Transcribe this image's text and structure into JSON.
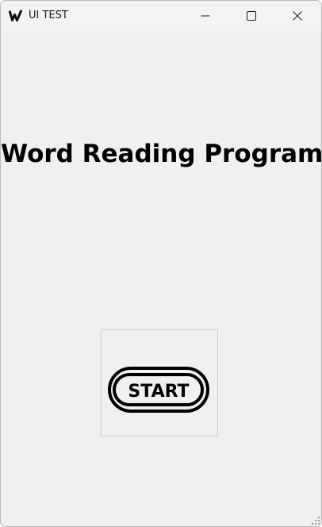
{
  "window": {
    "title": "UI TEST",
    "controls": {
      "minimize_icon": "minimize-icon",
      "maximize_icon": "maximize-icon",
      "close_icon": "close-icon"
    }
  },
  "main": {
    "heading": "Word Reading Program",
    "start_button": {
      "label": "START",
      "icon": "start-pill-icon"
    }
  },
  "colors": {
    "window_bg": "#f0f0f0",
    "titlebar_bg": "#f3f3f3",
    "text": "#000000",
    "button_border": "#b9d1ea"
  }
}
